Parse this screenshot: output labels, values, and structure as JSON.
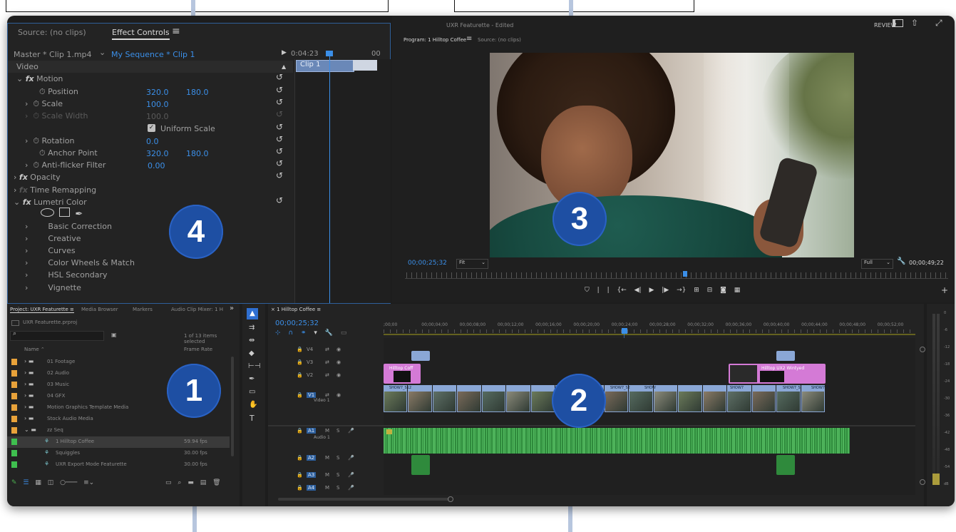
{
  "callouts": {
    "top_arrows": 2,
    "bottom_arrows": 2
  },
  "badges": {
    "b1": "1",
    "b2": "2",
    "b3": "3",
    "b4": "4"
  },
  "window": {
    "title": "UXR Featurette - Edited",
    "review": "REVIEW"
  },
  "effect_controls": {
    "tab_source": "Source: (no clips)",
    "tab_effect": "Effect Controls",
    "master": "Master * Clip 1.mp4",
    "sequence": "My Sequence * Clip 1",
    "timecode": "0:04:23",
    "timecode2": "00",
    "clip_label": "Clip 1",
    "section_video": "Video",
    "motion": "Motion",
    "position": "Position",
    "position_x": "320.0",
    "position_y": "180.0",
    "scale": "Scale",
    "scale_val": "100.0",
    "scale_width": "Scale Width",
    "scale_width_val": "100.0",
    "uniform": "Uniform Scale",
    "rotation": "Rotation",
    "rotation_val": "0.0",
    "anchor": "Anchor Point",
    "anchor_x": "320.0",
    "anchor_y": "180.0",
    "antiflicker": "Anti-flicker Filter",
    "antiflicker_val": "0.00",
    "opacity": "Opacity",
    "time_remap": "Time Remapping",
    "lumetri": "Lumetri Color",
    "basic": "Basic Correction",
    "creative": "Creative",
    "curves": "Curves",
    "wheels": "Color Wheels & Match",
    "hsl": "HSL Secondary",
    "vignette": "Vignette"
  },
  "program": {
    "tab_program": "Program: 1 Hilltop Coffee",
    "tab_source": "Source: (no clips)",
    "timecode": "00;00;25;32",
    "fit": "Fit",
    "full": "Full",
    "duration": "00;00;49;22"
  },
  "project": {
    "tabs": [
      "Project: UXR Featurette",
      "Media Browser",
      "Markers",
      "Audio Clip Mixer: 1 H"
    ],
    "file": "UXR Featurette.prproj",
    "count": "1 of 13 items selected",
    "col_name": "Name",
    "col_rate": "Frame Rate",
    "items": [
      {
        "name": "01 Footage",
        "rate": "",
        "color": "#e8a23a",
        "kind": "folder",
        "indent": 0
      },
      {
        "name": "02 Audio",
        "rate": "",
        "color": "#e8a23a",
        "kind": "folder",
        "indent": 0
      },
      {
        "name": "03 Music",
        "rate": "",
        "color": "#e8a23a",
        "kind": "folder",
        "indent": 0
      },
      {
        "name": "04 GFX",
        "rate": "",
        "color": "#e8a23a",
        "kind": "folder",
        "indent": 0
      },
      {
        "name": "Motion Graphics Template Media",
        "rate": "",
        "color": "#e8a23a",
        "kind": "folder",
        "indent": 0
      },
      {
        "name": "Stock Audio Media",
        "rate": "",
        "color": "#e8a23a",
        "kind": "folder",
        "indent": 0
      },
      {
        "name": "zz Seq",
        "rate": "",
        "color": "#e8a23a",
        "kind": "folder-open",
        "indent": 0
      },
      {
        "name": "1 Hilltop Coffee",
        "rate": "59.94 fps",
        "color": "#3fbf4f",
        "kind": "seq",
        "indent": 1
      },
      {
        "name": "Squiggles",
        "rate": "30.00 fps",
        "color": "#3fbf4f",
        "kind": "seq",
        "indent": 1
      },
      {
        "name": "UXR Export Mode Featurette",
        "rate": "30.00 fps",
        "color": "#3fbf4f",
        "kind": "seq",
        "indent": 1
      }
    ]
  },
  "timeline": {
    "tab": "1 Hilltop Coffee",
    "timecode": "00;00;25;32",
    "ruler": [
      ";00;00",
      "00;00;04;00",
      "00;00;08;00",
      "00;00;12;00",
      "00;00;16;00",
      "00;00;20;00",
      "00;00;24;00",
      "00;00;28;00",
      "00;00;32;00",
      "00;00;36;00",
      "00;00;40;00",
      "00;00;44;00",
      "00;00;48;00",
      "00;00;52;00"
    ],
    "tracks": [
      "V4",
      "V3",
      "V2",
      "V1",
      "A1",
      "A2",
      "A3",
      "A4"
    ],
    "video1": "Video 1",
    "audio1": "Audio 1",
    "clips_v2": [
      "Hilltop Coff",
      "Hilltop UX2 Wintyed"
    ],
    "clips_v1": [
      "SHOW7_S12",
      "SHOW7",
      "SHOW7_S2",
      "SHOW",
      "SHOW7",
      "SHOW7_S",
      "SHOW7_S"
    ],
    "meter": [
      "0",
      "-6",
      "-12",
      "-18",
      "-24",
      "-30",
      "-36",
      "-42",
      "-48",
      "-54",
      "dB"
    ]
  },
  "colors": {
    "accent": "#3b8fe8",
    "panel": "#232323",
    "badge": "#1e4fa3",
    "audio": "#3fa04a",
    "video": "#8aa7d6",
    "graphic": "#d47ad6"
  }
}
